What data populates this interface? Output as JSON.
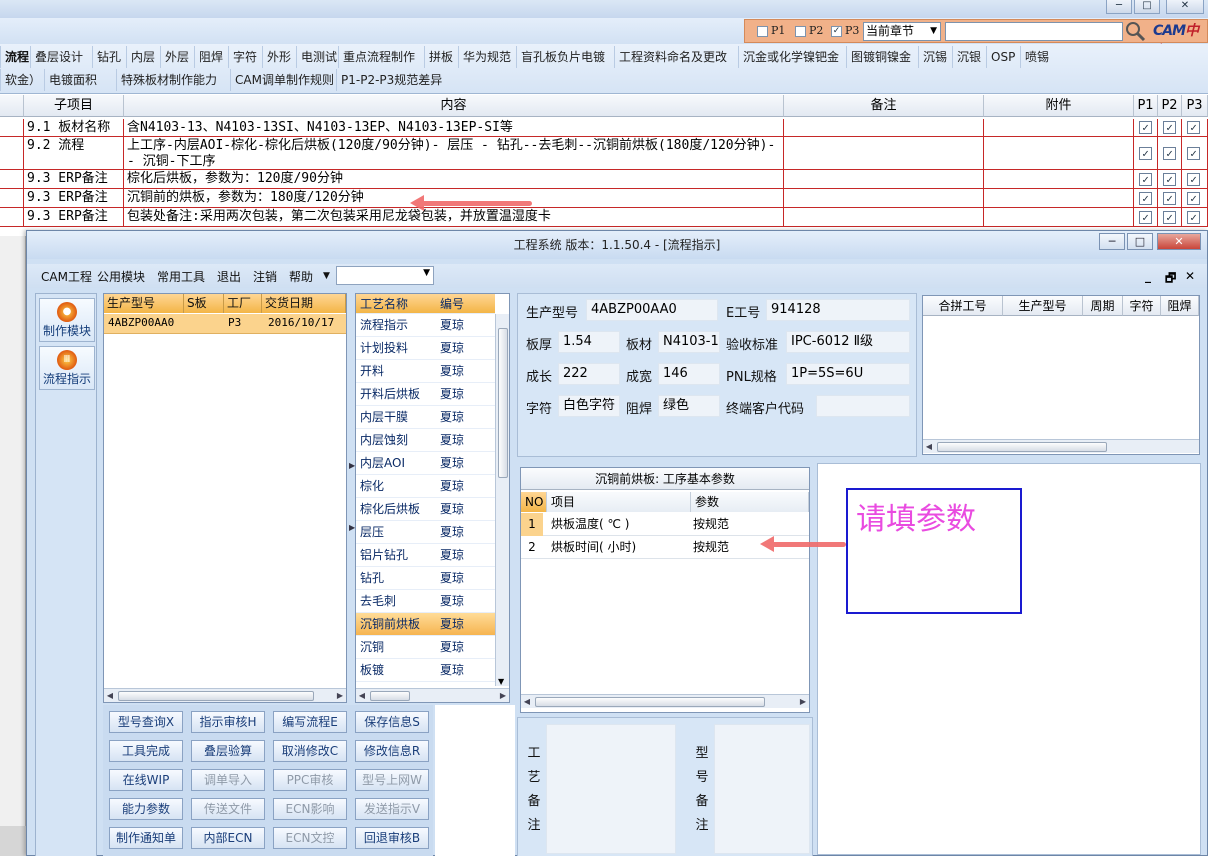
{
  "toolbar": {
    "p_options": [
      {
        "label": "P1",
        "checked": false
      },
      {
        "label": "P2",
        "checked": false
      },
      {
        "label": "P3",
        "checked": true
      }
    ],
    "chapter_select": "当前章节",
    "search_value": "",
    "logo": {
      "brand": "CAM",
      "text": "中心"
    }
  },
  "tabs_row1": [
    "流程",
    "叠层设计",
    "钻孔",
    "内层",
    "外层",
    "阻焊",
    "字符",
    "外形",
    "电测试",
    "重点流程制作",
    "拼板",
    "华为规范",
    "盲孔板负片电镀",
    "工程资料命名及更改",
    "沉金或化学镍钯金",
    "图镀铜镍金",
    "沉锡",
    "沉银",
    "OSP",
    "喷锡"
  ],
  "tabs_row2": [
    "软金）",
    "电镀面积",
    "特殊板材制作能力",
    "CAM调单制作规则",
    "P1-P2-P3规范差异"
  ],
  "grid": {
    "headers": [
      "子项目",
      "内容",
      "备注",
      "附件",
      "P1",
      "P2",
      "P3"
    ],
    "rows": [
      {
        "item": "9.1 板材名称",
        "content": "含N4103-13、N4103-13SI、N4103-13EP、N4103-13EP-SI等",
        "note": "",
        "attach": ""
      },
      {
        "item": "9.2 流程",
        "content": "上工序-内层AOI-棕化-棕化后烘板(120度/90分钟)- 层压 - 钻孔--去毛刺--沉铜前烘板(180度/120分钟)-- 沉铜-下工序",
        "note": "",
        "attach": ""
      },
      {
        "item": "9.3 ERP备注",
        "content": "棕化后烘板，参数为：120度/90分钟",
        "note": "",
        "attach": ""
      },
      {
        "item": "9.3 ERP备注",
        "content": "沉铜前的烘板，参数为：180度/120分钟",
        "note": "",
        "attach": ""
      },
      {
        "item": "9.3 ERP备注",
        "content": "包装处备注:采用两次包装，第二次包装采用尼龙袋包装，并放置温湿度卡",
        "note": "",
        "attach": ""
      }
    ]
  },
  "window": {
    "title": "工程系统  版本：1.1.50.4 - [流程指示]",
    "controls": [
      "─",
      "□",
      "✕"
    ],
    "menu": [
      "CAM工程",
      "公用模块",
      "常用工具",
      "退出",
      "注销",
      "帮助"
    ],
    "mdi_controls": [
      "_",
      "🗗",
      "✕"
    ]
  },
  "left_nav": [
    {
      "label": "制作模块",
      "icon": "flame-icon"
    },
    {
      "label": "流程指示",
      "icon": "flow-icon"
    }
  ],
  "product_grid": {
    "headers": [
      "生产型号",
      "S板",
      "工厂",
      "交货日期"
    ],
    "rows": [
      {
        "model": "4ABZP00AA0",
        "s": "",
        "factory": "P3",
        "date": "2016/10/17"
      }
    ]
  },
  "process_list": {
    "headers": [
      "工艺名称",
      "编号"
    ],
    "items": [
      {
        "name": "流程指示",
        "owner": "夏琼",
        "selected": false
      },
      {
        "name": "计划投料",
        "owner": "夏琼",
        "selected": false
      },
      {
        "name": "开料",
        "owner": "夏琼",
        "selected": false
      },
      {
        "name": "开料后烘板",
        "owner": "夏琼",
        "selected": false
      },
      {
        "name": "内层干膜",
        "owner": "夏琼",
        "selected": false
      },
      {
        "name": "内层蚀刻",
        "owner": "夏琼",
        "selected": false
      },
      {
        "name": "内层AOI",
        "owner": "夏琼",
        "selected": false
      },
      {
        "name": "棕化",
        "owner": "夏琼",
        "selected": false
      },
      {
        "name": "棕化后烘板",
        "owner": "夏琼",
        "selected": false
      },
      {
        "name": "层压",
        "owner": "夏琼",
        "selected": false
      },
      {
        "name": "铝片钻孔",
        "owner": "夏琼",
        "selected": false
      },
      {
        "name": "钻孔",
        "owner": "夏琼",
        "selected": false
      },
      {
        "name": "去毛刺",
        "owner": "夏琼",
        "selected": false
      },
      {
        "name": "沉铜前烘板",
        "owner": "夏琼",
        "selected": true
      },
      {
        "name": "沉铜",
        "owner": "夏琼",
        "selected": false
      },
      {
        "name": "板镀",
        "owner": "夏琼",
        "selected": false
      }
    ]
  },
  "action_buttons": [
    {
      "label": "型号查询X",
      "enabled": true
    },
    {
      "label": "指示审核H",
      "enabled": true
    },
    {
      "label": "编写流程E",
      "enabled": true
    },
    {
      "label": "保存信息S",
      "enabled": true
    },
    {
      "label": "工具完成",
      "enabled": true
    },
    {
      "label": "叠层验算",
      "enabled": true
    },
    {
      "label": "取消修改C",
      "enabled": true
    },
    {
      "label": "修改信息R",
      "enabled": true
    },
    {
      "label": "在线WIP",
      "enabled": true
    },
    {
      "label": "调单导入",
      "enabled": false
    },
    {
      "label": "PPC审核",
      "enabled": false
    },
    {
      "label": "型号上网W",
      "enabled": false
    },
    {
      "label": "能力参数",
      "enabled": true
    },
    {
      "label": "传送文件",
      "enabled": false
    },
    {
      "label": "ECN影响",
      "enabled": false
    },
    {
      "label": "发送指示V",
      "enabled": false
    },
    {
      "label": "制作通知单",
      "enabled": true
    },
    {
      "label": "内部ECN",
      "enabled": true
    },
    {
      "label": "ECN文控",
      "enabled": false
    },
    {
      "label": "回退审核B",
      "enabled": true
    }
  ],
  "info": {
    "model_label": "生产型号",
    "model": "4ABZP00AA0",
    "eng_label": "E工号",
    "eng": "914128",
    "thick_label": "板厚",
    "thick": "1.54",
    "material_label": "板材",
    "material": "N4103-1",
    "std_label": "验收标准",
    "std": "IPC-6012 Ⅱ级",
    "len_label": "成长",
    "len": "222",
    "width_label": "成宽",
    "width": "146",
    "pnl_label": "PNL规格",
    "pnl": "1P=5S=6U",
    "char_label": "字符",
    "char": "白色字符",
    "mask_label": "阻焊",
    "mask": "绿色",
    "client_label": "终端客户代码",
    "client": ""
  },
  "merge_grid": {
    "headers": [
      "合拼工号",
      "生产型号",
      "周期",
      "字符",
      "阻焊"
    ]
  },
  "param_grid": {
    "title": "沉铜前烘板: 工序基本参数",
    "headers": [
      "NO",
      "项目",
      "参数"
    ],
    "rows": [
      {
        "no": "1",
        "item": "烘板温度( ℃ )",
        "value": "按规范"
      },
      {
        "no": "2",
        "item": "烘板时间( 小时)",
        "value": "按规范"
      }
    ]
  },
  "remarks": {
    "process_label": "工艺备注",
    "model_label": "型号备注"
  },
  "annotation": {
    "text": "请填参数"
  },
  "colors": {
    "accent_orange": "#f3b547",
    "annotation_pink": "#e94be0",
    "annotation_blue": "#1a1ad0",
    "arrow_red": "#f06a6a",
    "grid_red": "#c62828"
  }
}
